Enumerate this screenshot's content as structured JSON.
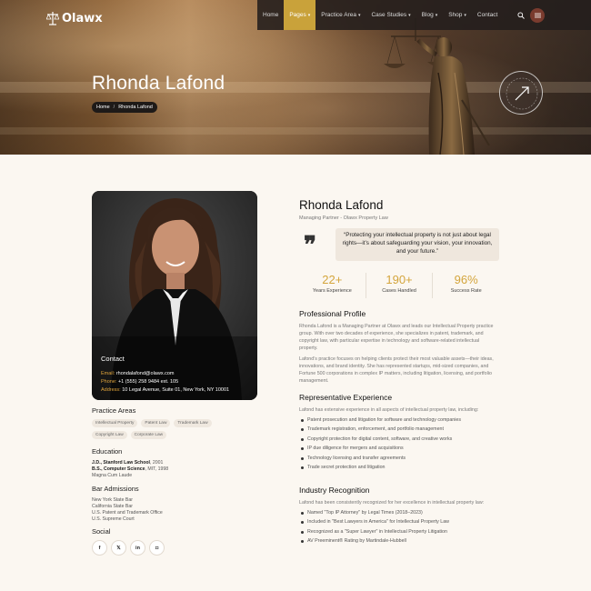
{
  "brand": {
    "logo_text": "Olawx"
  },
  "nav": {
    "items": [
      {
        "label": "Home",
        "caret": false,
        "active": false
      },
      {
        "label": "Pages",
        "caret": true,
        "active": true
      },
      {
        "label": "Practice Area",
        "caret": true,
        "active": false
      },
      {
        "label": "Case Studies",
        "caret": true,
        "active": false
      },
      {
        "label": "Blog",
        "caret": true,
        "active": false
      },
      {
        "label": "Shop",
        "caret": true,
        "active": false
      },
      {
        "label": "Contact",
        "caret": false,
        "active": false
      }
    ],
    "accent": "#c9a23a"
  },
  "hero": {
    "title": "Rhonda Lafond",
    "breadcrumb": {
      "home": "Home",
      "separator": "/",
      "current": "Rhonda Lafond"
    },
    "seal_text": "Need Any Help • Contact Us •"
  },
  "contact": {
    "title": "Contact",
    "email_label": "Email:",
    "email": "rhondalafond@olawx.com",
    "phone_label": "Phone:",
    "phone": "+1 (555) 258 9484 ext. 105",
    "address_label": "Address:",
    "address": "10 Legal Avenue, Suite 01, New York, NY 10001"
  },
  "practice_areas": {
    "heading": "Practice Areas",
    "tags": [
      "Intellectual Property",
      "Patent Law",
      "Trademark Law",
      "Copyright Law",
      "Corporate Law"
    ]
  },
  "education": {
    "heading": "Education",
    "lines": [
      {
        "degree": "J.D., Stanford Law School",
        "year": ", 2001"
      },
      {
        "degree": "B.S., Computer Science",
        "year": ", MIT, 1998"
      }
    ],
    "honor": "Magna Cum Laude"
  },
  "bar_admissions": {
    "heading": "Bar Admissions",
    "items": [
      "New York State Bar",
      "California State Bar",
      "U.S. Patent and Trademark Office",
      "U.S. Supreme Court"
    ]
  },
  "social": {
    "heading": "Social",
    "icons": [
      {
        "name": "facebook-icon",
        "glyph": "f"
      },
      {
        "name": "x-icon",
        "glyph": "𝕏"
      },
      {
        "name": "linkedin-icon",
        "glyph": "in"
      },
      {
        "name": "instagram-icon",
        "glyph": "◘"
      }
    ]
  },
  "profile": {
    "name": "Rhonda Lafond",
    "role": "Managing Partner - Olawx Property Law",
    "quote": "“Protecting your intellectual property is not just about legal rights—it’s about safeguarding your vision, your innovation, and your future.”",
    "stats": [
      {
        "value": "22+",
        "label": "Years Experience"
      },
      {
        "value": "190+",
        "label": "Cases Handled"
      },
      {
        "value": "96%",
        "label": "Success Rate"
      }
    ]
  },
  "professional_profile": {
    "heading": "Professional Profile",
    "paragraphs": [
      "Rhonda Lafond is a Managing Partner at Olawx and leads our Intellectual Property practice group. With over two decades of experience, she specializes in patent, trademark, and copyright law, with particular expertise in technology and software-related intellectual property.",
      "Lafond’s practice focuses on helping clients protect their most valuable assets—their ideas, innovations, and brand identity. She has represented startups, mid-sized companies, and Fortune 500 corporations in complex IP matters, including litigation, licensing, and portfolio management."
    ]
  },
  "representative_experience": {
    "heading": "Representative Experience",
    "intro": "Lafond has extensive experience in all aspects of intellectual property law, including:",
    "items": [
      "Patent prosecution and litigation for software and technology companies",
      "Trademark registration, enforcement, and portfolio management",
      "Copyright protection for digital content, software, and creative works",
      "IP due diligence for mergers and acquisitions",
      "Technology licensing and transfer agreements",
      "Trade secret protection and litigation"
    ]
  },
  "industry_recognition": {
    "heading": "Industry Recognition",
    "intro": "Lafond has been consistently recognized for her excellence in intellectual property law:",
    "items": [
      "Named \"Top IP Attorney\" by Legal Times (2018–2023)",
      "Included in \"Best Lawyers in America\" for Intellectual Property Law",
      "Recognized as a \"Super Lawyer\" in Intellectual Property Litigation",
      "AV Preeminent® Rating by Martindale-Hubbell"
    ]
  }
}
